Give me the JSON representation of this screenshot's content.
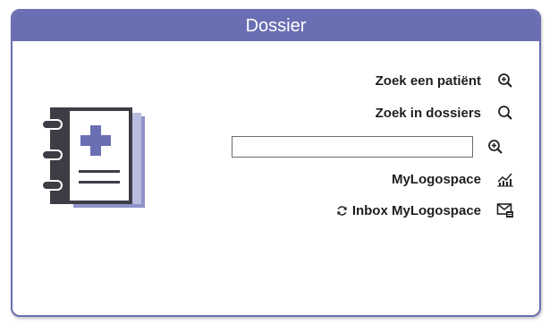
{
  "panel": {
    "title": "Dossier"
  },
  "menu": {
    "search_patient": {
      "label": "Zoek een patiënt",
      "icon": "zoom-in-icon"
    },
    "search_dossiers": {
      "label": "Zoek in dossiers",
      "icon": "search-icon"
    },
    "search_input": {
      "value": "",
      "placeholder": ""
    },
    "search_button": {
      "icon": "zoom-in-icon"
    },
    "mylogospace": {
      "label": "MyLogospace",
      "icon": "chart-icon"
    },
    "inbox": {
      "label": "Inbox MyLogospace",
      "icon": "inbox-icon",
      "prefix_icon": "refresh-icon"
    }
  },
  "colors": {
    "accent": "#6a6fb3",
    "notebook_cover": "#3d3d45",
    "cross": "#6a6fb3"
  }
}
